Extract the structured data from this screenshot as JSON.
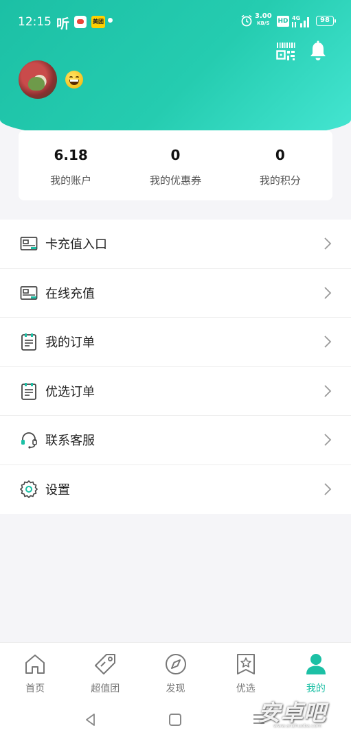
{
  "status_bar": {
    "time": "12:15",
    "listen_glyph": "听",
    "app_badge": "美团",
    "speed_value": "3.00",
    "speed_unit": "KB/S",
    "hd": "HD",
    "network": "4G",
    "battery": "98"
  },
  "header": {
    "qr_icon": "qr-scan-icon",
    "bell_icon": "bell-icon"
  },
  "stats": [
    {
      "value": "6.18",
      "label": "我的账户"
    },
    {
      "value": "0",
      "label": "我的优惠券"
    },
    {
      "value": "0",
      "label": "我的积分"
    }
  ],
  "menu": [
    {
      "label": "卡充值入口",
      "icon": "card-icon"
    },
    {
      "label": "在线充值",
      "icon": "card-icon"
    },
    {
      "label": "我的订单",
      "icon": "clipboard-icon"
    },
    {
      "label": "优选订单",
      "icon": "clipboard-icon"
    },
    {
      "label": "联系客服",
      "icon": "headset-icon"
    },
    {
      "label": "设置",
      "icon": "gear-icon"
    }
  ],
  "tabs": [
    {
      "label": "首页",
      "icon": "home-icon",
      "active": false
    },
    {
      "label": "超值团",
      "icon": "tag-icon",
      "active": false
    },
    {
      "label": "发现",
      "icon": "compass-icon",
      "active": false
    },
    {
      "label": "优选",
      "icon": "star-bookmark-icon",
      "active": false
    },
    {
      "label": "我的",
      "icon": "person-icon",
      "active": true
    }
  ],
  "watermark": {
    "text": "安卓吧",
    "sub": "www.anzhuoba.com"
  },
  "colors": {
    "accent": "#1cc0a5",
    "accent_light": "#45e6d2",
    "page_bg": "#f5f5f8"
  }
}
